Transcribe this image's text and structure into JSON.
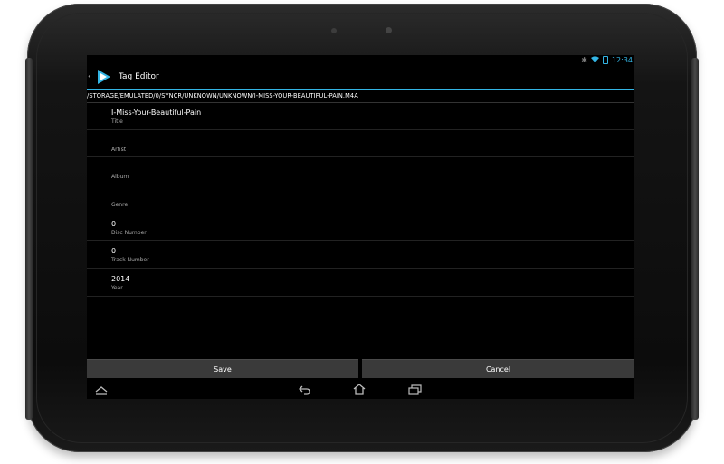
{
  "status_bar": {
    "time": "12:34",
    "icons": [
      "bluetooth-icon",
      "wifi-icon",
      "battery-icon"
    ],
    "accent_color": "#33b5e5"
  },
  "action_bar": {
    "title": "Tag Editor",
    "app_icon": "play-logo-icon"
  },
  "file_path": "/STORAGE/EMULATED/0/SYNCR/UNKNOWN/UNKNOWN/I-MISS-YOUR-BEAUTIFUL-PAIN.M4A",
  "fields": [
    {
      "value": "I-Miss-Your-Beautiful-Pain",
      "label": "Title"
    },
    {
      "value": "",
      "label": "Artist"
    },
    {
      "value": "",
      "label": "Album"
    },
    {
      "value": "",
      "label": "Genre"
    },
    {
      "value": "0",
      "label": "Disc Number"
    },
    {
      "value": "0",
      "label": "Track Number"
    },
    {
      "value": "2014",
      "label": "Year"
    }
  ],
  "buttons": {
    "save_label": "Save",
    "cancel_label": "Cancel"
  },
  "nav_bar": {
    "icons": [
      "home-collapse-icon",
      "back-icon",
      "home-icon",
      "recent-apps-icon"
    ]
  }
}
